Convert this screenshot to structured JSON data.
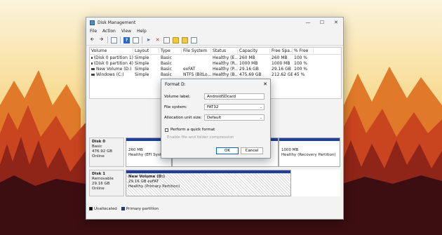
{
  "window": {
    "title": "Disk Management"
  },
  "menu": [
    "File",
    "Action",
    "View",
    "Help"
  ],
  "volume_table": {
    "headers": [
      "Volume",
      "Layout",
      "Type",
      "File System",
      "Status",
      "Capacity",
      "Free Spa...",
      "% Free"
    ],
    "rows": [
      [
        "(Disk 0 partition 1)",
        "Simple",
        "Basic",
        "",
        "Healthy (E...",
        "260 MB",
        "260 MB",
        "100 %"
      ],
      [
        "(Disk 0 partition 4)",
        "Simple",
        "Basic",
        "",
        "Healthy (R...",
        "1000 MB",
        "1000 MB",
        "100 %"
      ],
      [
        "New Volume (D:)",
        "Simple",
        "Basic",
        "exFAT",
        "Healthy (P...",
        "29.16 GB",
        "29.16 GB",
        "100 %"
      ],
      [
        "Windows (C:)",
        "Simple",
        "Basic",
        "NTFS (BitLo...",
        "Healthy (B...",
        "475.69 GB",
        "212.62 GB",
        "45 %"
      ]
    ]
  },
  "disks": [
    {
      "name": "Disk 0",
      "type": "Basic",
      "size": "476.92 GB",
      "status": "Online",
      "partitions": [
        {
          "size": "260 MB",
          "status": "Healthy (EFI System"
        },
        {
          "size": "",
          "status": ""
        },
        {
          "size": "1000 MB",
          "status": "Healthy (Recovery Partition)"
        }
      ]
    },
    {
      "name": "Disk 1",
      "type": "Removable",
      "size": "29.16 GB",
      "status": "Online",
      "partitions": [
        {
          "name": "New Volume  (D:)",
          "size": "29.16 GB exFAT",
          "status": "Healthy (Primary Partition)"
        }
      ]
    }
  ],
  "legend": [
    {
      "label": "Unallocated",
      "color": "#000000"
    },
    {
      "label": "Primary partition",
      "color": "#1f3f9e"
    }
  ],
  "dialog": {
    "title": "Format D:",
    "volume_label_label": "Volume label:",
    "volume_label_value": "AndroidSDcard",
    "file_system_label": "File system:",
    "file_system_value": "FAT32",
    "alloc_label": "Allocation unit size:",
    "alloc_value": "Default",
    "quick_format": "Perform a quick format",
    "compression": "Enable file and folder compression",
    "ok": "OK",
    "cancel": "Cancel"
  },
  "colors": {
    "accent": "#0067c0",
    "partition_bar": "#1f3f9e"
  }
}
